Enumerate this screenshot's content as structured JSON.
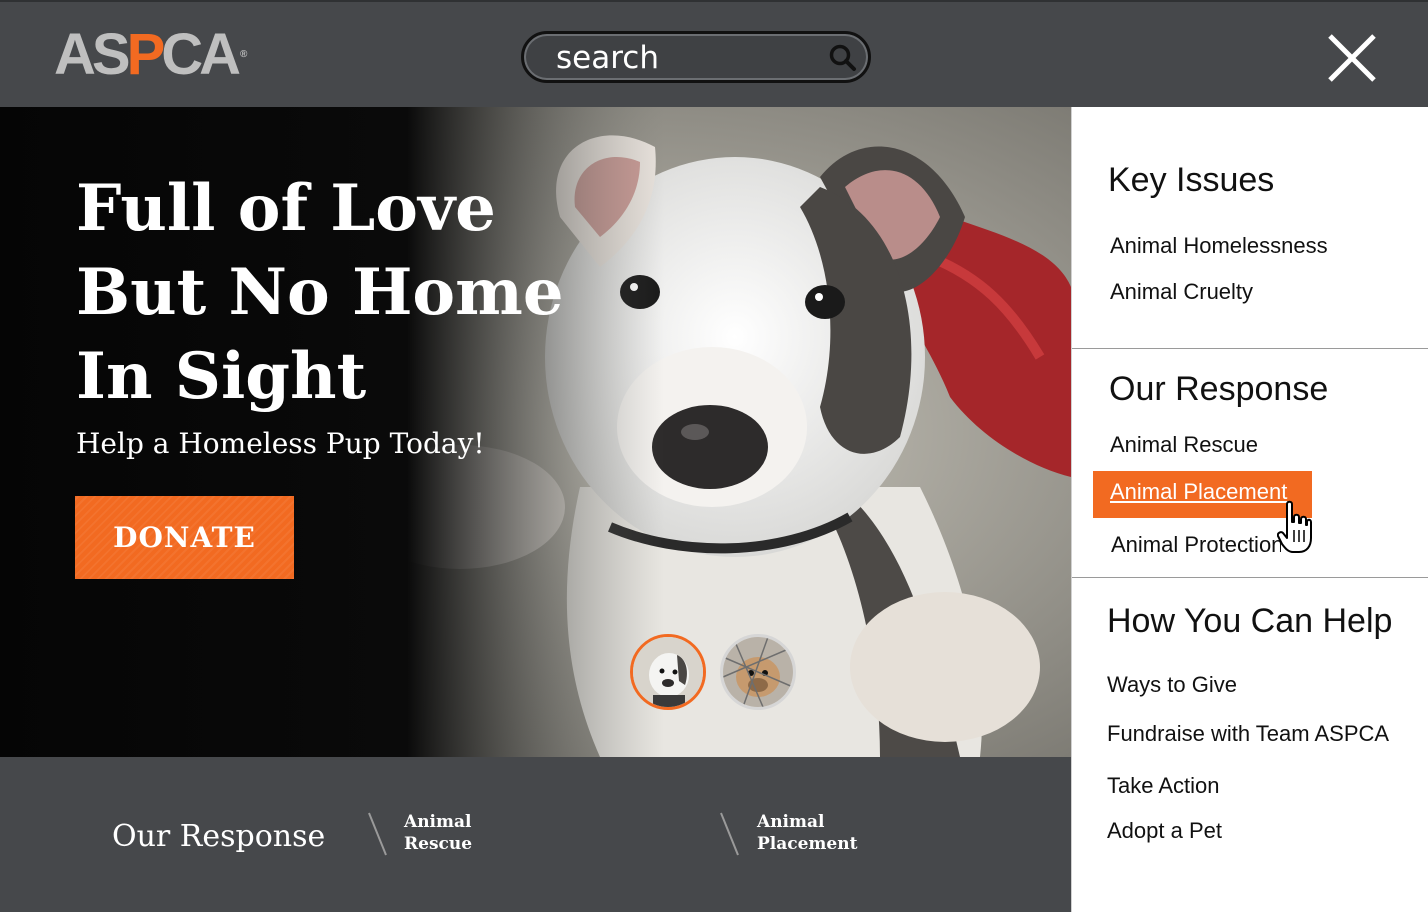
{
  "header": {
    "logo": {
      "pre": "AS",
      "p": "P",
      "post": "CA",
      "reg": "®"
    },
    "search_placeholder": "search",
    "close_icon": "close-icon"
  },
  "hero": {
    "title_lines": [
      "Full of Love",
      "But No Home",
      "In Sight"
    ],
    "subtitle": "Help a Homeless Pup Today!",
    "donate_label": "DONATE"
  },
  "footer": {
    "title": "Our Response",
    "links": [
      {
        "line1": "Animal",
        "line2": "Rescue"
      },
      {
        "line1": "Animal",
        "line2": "Placement"
      }
    ]
  },
  "menu": {
    "sections": [
      {
        "heading": "Key Issues",
        "items": [
          "Animal Homelessness",
          "Animal Cruelty"
        ]
      },
      {
        "heading": "Our Response",
        "items": [
          "Animal Rescue",
          "Animal Placement",
          "Animal Protection"
        ]
      },
      {
        "heading": "How You Can Help",
        "items": [
          "Ways to Give",
          "Fundraise with Team ASPCA",
          "Take Action",
          "Adopt a Pet"
        ]
      }
    ],
    "active_item": "Animal Placement"
  },
  "colors": {
    "accent": "#f26a21",
    "bar": "#46484b",
    "logo_gray": "#bfbfbf"
  }
}
